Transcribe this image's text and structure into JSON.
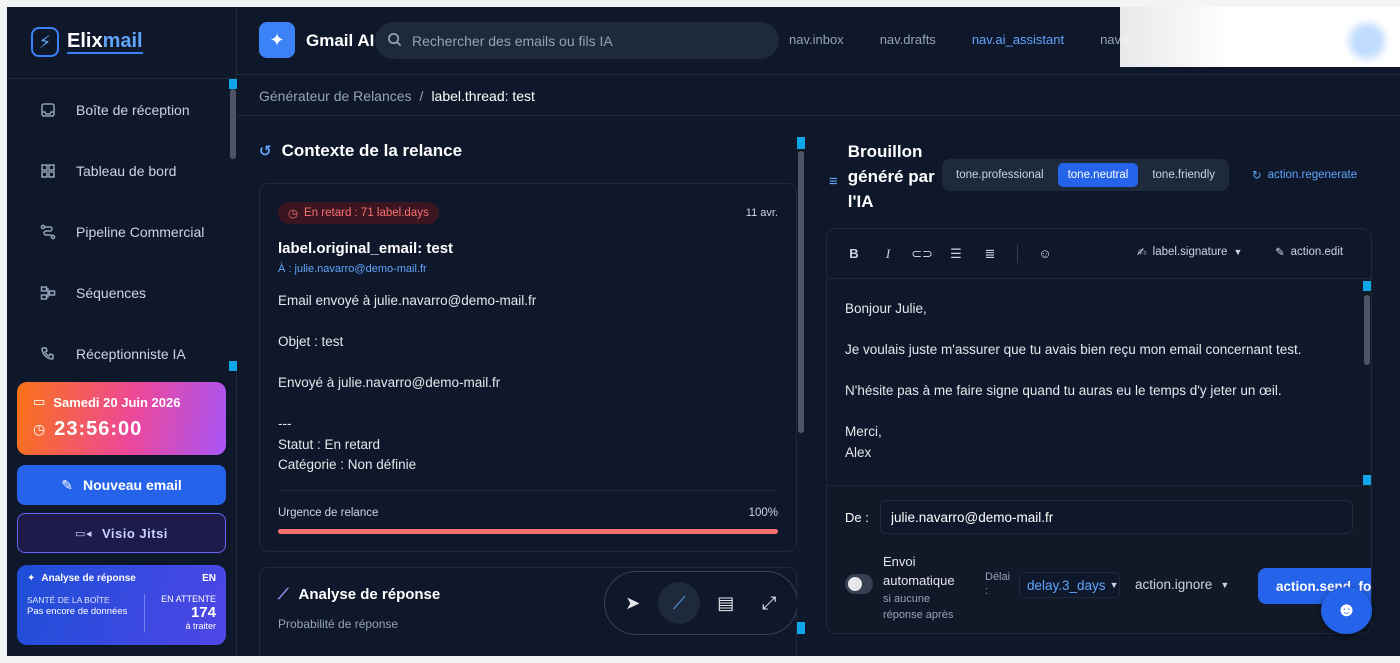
{
  "app": {
    "logo_text_a": "Elix",
    "logo_text_b": "mail",
    "name": "Gmail AI"
  },
  "search": {
    "placeholder": "Rechercher des emails ou fils IA"
  },
  "topnav": [
    "nav.inbox",
    "nav.drafts",
    "nav.ai_assistant",
    "nav.s"
  ],
  "sidebar": {
    "items": [
      {
        "label": "Boîte de réception",
        "icon": "inbox-icon"
      },
      {
        "label": "Tableau de bord",
        "icon": "dashboard-icon"
      },
      {
        "label": "Pipeline Commercial",
        "icon": "pipeline-icon"
      },
      {
        "label": "Séquences",
        "icon": "sequences-icon"
      },
      {
        "label": "Réceptionniste IA",
        "icon": "phone-icon"
      }
    ]
  },
  "datecard": {
    "date": "Samedi 20 Juin 2026",
    "time": "23:56:00"
  },
  "buttons": {
    "new_email": "Nouveau email",
    "visio": "Visio Jitsi"
  },
  "analysis_card": {
    "title": "Analyse de réponse",
    "lang": "EN",
    "health_label": "SANTÉ DE LA BOÎTE",
    "health_value": "Pas encore de données",
    "pending_label": "EN ATTENTE",
    "pending_count": "174",
    "pending_sub": "à traiter"
  },
  "breadcrumb": {
    "parent": "Générateur de Relances",
    "sep": "/",
    "current": "label.thread: test"
  },
  "context": {
    "title": "Contexte de la relance",
    "badge": "En retard : 71 label.days",
    "date": "11 avr.",
    "subject": "label.original_email: test",
    "to": "À : julie.navarro@demo-mail.fr",
    "body": [
      "Email envoyé à julie.navarro@demo-mail.fr",
      "",
      "Objet : test",
      "",
      "Envoyé à julie.navarro@demo-mail.fr",
      "",
      "---",
      "Statut : En retard",
      "Catégorie : Non définie"
    ],
    "urgency_label": "Urgence de relance",
    "urgency_value": "100%",
    "urgency_fraction": 1.0
  },
  "analysis": {
    "title": "Analyse de réponse",
    "prob_label": "Probabilité de réponse"
  },
  "draft": {
    "title_lines": [
      "Brouillon",
      "généré par",
      "l'IA"
    ],
    "tones": [
      "tone.professional",
      "tone.neutral",
      "tone.friendly"
    ],
    "selected_tone": "tone.neutral",
    "regenerate": "action.regenerate",
    "signature": "label.signature",
    "edit": "action.edit",
    "body": [
      "Bonjour Julie,",
      "",
      "Je voulais juste m'assurer que tu avais bien reçu mon email concernant test.",
      "",
      "N'hésite pas à me faire signe quand tu auras eu le temps d'y jeter un œil.",
      "",
      "Merci,",
      "Alex"
    ],
    "from_label": "De :",
    "from_value": "julie.navarro@demo-mail.fr",
    "auto_label_lines": [
      "Envoi",
      "automatique"
    ],
    "auto_sub_lines": [
      "si aucune",
      "réponse après"
    ],
    "delay_label": "Délai :",
    "delay_value": "delay.3_days",
    "ignore": "action.ignore",
    "send": "action.send_foll"
  }
}
